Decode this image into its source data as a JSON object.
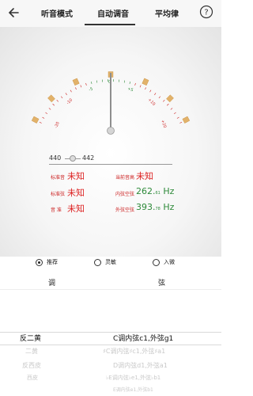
{
  "header": {
    "tabs": [
      {
        "label": "听音模式"
      },
      {
        "label": "自动调音"
      },
      {
        "label": "平均律"
      }
    ],
    "active_tab": 1,
    "help": "?"
  },
  "gauge": {
    "labels_red": [
      "-20",
      "-10",
      "+10",
      "+20"
    ],
    "labels_green": [
      "-5",
      "+5"
    ],
    "zero": "0",
    "needle_value": 0
  },
  "frequency": {
    "left": "440",
    "right": "442"
  },
  "info": {
    "standard_tone_label": "标准音",
    "standard_tone_value": "未知",
    "current_tone_label": "当前音高",
    "current_tone_value": "未知",
    "standard_string_label": "标准弦",
    "standard_string_value": "未知",
    "inner_string_label": "内弦空弦",
    "inner_string_value": "262.",
    "inner_string_sub": "61",
    "inner_string_unit": "Hz",
    "tone_label": "音 准",
    "tone_value": "未知",
    "outer_string_label": "外弦空弦",
    "outer_string_value": "393.",
    "outer_string_sub": "78",
    "outer_string_unit": "Hz"
  },
  "modes": [
    {
      "label": "推荐",
      "selected": true
    },
    {
      "label": "灵敏",
      "selected": false
    },
    {
      "label": "入微",
      "selected": false
    }
  ],
  "table": {
    "col1": "调",
    "col2": "弦",
    "rows": [
      {
        "key": "反二黄",
        "strings": "C调内弦c1,外弦g1",
        "selected": true
      },
      {
        "key": "二黄",
        "strings": "♯C调内弦♯c1,外弦♯a1",
        "selected": false
      },
      {
        "key": "反西皮",
        "strings": "D调内弦d1,外弦a1",
        "selected": false
      },
      {
        "key": "西皮",
        "strings": "♭E调内弦♭e1,外弦♭b1",
        "selected": false
      },
      {
        "key": "",
        "strings": "E调内弦e1,外弦b1",
        "selected": false
      }
    ]
  },
  "colors": {
    "accent_red": "#cc2222",
    "accent_green": "#2e8a3a",
    "tick_orange": "#e2b26a"
  }
}
